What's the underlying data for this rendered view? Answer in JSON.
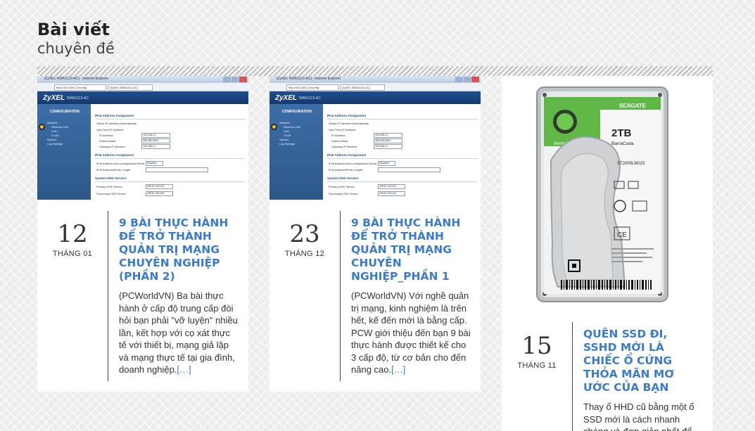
{
  "section": {
    "title_bold": "Bài viết",
    "title_light": "chuyên đề"
  },
  "colors": {
    "accent": "#3a7bd0",
    "page_bg": "#ececec",
    "card_bg": "#ffffff"
  },
  "posts": [
    {
      "day": "12",
      "month": "THÁNG 01",
      "title": "9 BÀI THỰC HÀNH ĐỂ TRỞ THÀNH QUẢN TRỊ MẠNG CHUYÊN NGHIỆP (PHẦN 2)",
      "excerpt": "(PCWorldVN) Ba bài thực hành ở cấp độ trung cấp đòi hỏi bạn phải \"vỡ luyện\" nhiều lần, kết hợp với cọ xát thực tế với thiết bị, mạng giả lập và mạng thực tế tại gia đình, doanh nghiệp.",
      "read_more": "[…]",
      "thumbnail": "router-config-screenshot"
    },
    {
      "day": "23",
      "month": "THÁNG 12",
      "title": "9 BÀI THỰC HÀNH ĐỂ TRỞ THÀNH QUẢN TRỊ MẠNG CHUYÊN NGHIỆP_PHẦN 1",
      "excerpt": "(PCWorldVN) Với nghề quản trị mạng, kinh nghiệm là trên hết, kế đến mới là bằng cấp. PCW giới thiệu đến bạn 9 bài thực hành được thiết kế cho 3 cấp độ, từ cơ bản cho đến nâng cao.",
      "read_more": "[…]",
      "thumbnail": "router-config-screenshot"
    },
    {
      "day": "15",
      "month": "THÁNG 11",
      "title": "QUÊN SSD ĐI, SSHD MỚI LÀ CHIẾC Ổ CỨNG THỎA MÃN MƠ ƯỚC CỦA BẠN",
      "excerpt": "Thay ổ HHD cũ bằng một ổ SSD mới là cách nhanh chóng và đơn giản nhất để",
      "thumbnail": "hard-drive-photo"
    }
  ],
  "screenshot": {
    "window_title": "[ZyXEL NWA1123-AC] - Internet Explorer",
    "url": "http://192.168.1.2/config",
    "tab": "[ZyXEL NWA1123-AC]",
    "brand": "ZyXEL",
    "model": "NWA1123-AC",
    "nav_config": "CONFIGURATION",
    "nav_items": [
      "Network",
      "Wireless LAN",
      "LAN",
      "VLAN",
      "System",
      "Log Settings"
    ],
    "sec_ipv4": "IPv4 Address Assignment",
    "opt_auto": "Obtain IP Address Automatically",
    "opt_fixed": "Use Fixed IP Address",
    "lbl_ip": "IP Address:",
    "val_ip": "192.168.1.2",
    "lbl_mask": "Subnet Mask:",
    "val_mask": "255.255.255.0",
    "lbl_gw": "Gateway IP Address:",
    "val_gw": "192.168.1.1",
    "sec_ipv6": "IPv6 Address Assignment",
    "lbl_v6mode": "IPv6 Address Auto-configuration Mode:",
    "val_v6mode": "Disabled",
    "lbl_v6prefix": "IPv6 Address/Prefix Length:",
    "sec_dns": "System DNS Servers",
    "lbl_dns1": "Primary DNS Server:",
    "val_dns1": "209.67.222.222",
    "lbl_dns2": "Secondary DNS Server:",
    "val_dns2": "209.67.220.220"
  },
  "hdd": {
    "brand": "SEAGATE",
    "series_badge": "BARRACUDA",
    "capacity": "2TB",
    "line": "BarraCuda",
    "model": "ST2000LM015"
  }
}
